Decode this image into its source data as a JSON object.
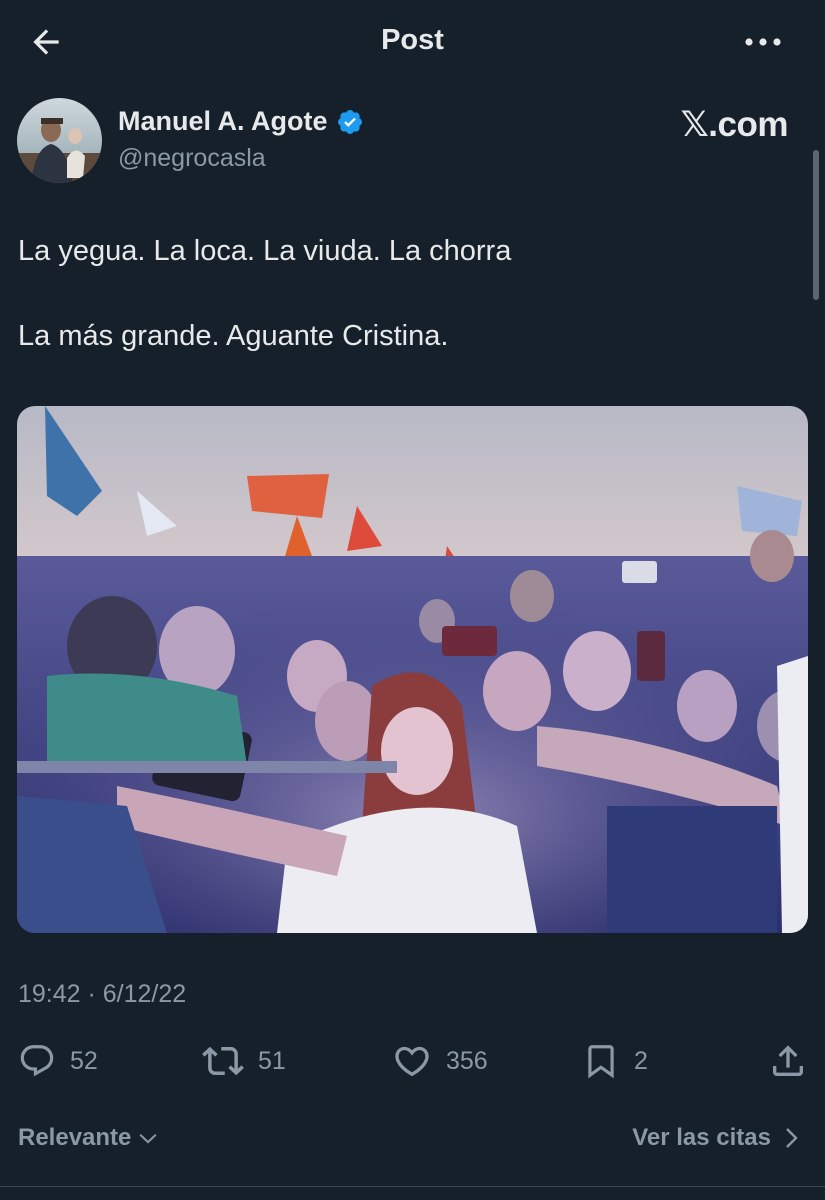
{
  "header": {
    "title": "Post",
    "back_icon": "arrow-left-icon",
    "more_icon": "more-horizontal-icon"
  },
  "author": {
    "name": "Manuel A. Agote",
    "handle": "@negrocasla",
    "verified_icon": "verified-badge-icon",
    "verified_color": "#1d9bf0"
  },
  "watermark": "𝕏.com",
  "tweet": {
    "lines": [
      "La yegua. La loca. La viuda. La chorra",
      "La más grande. Aguante Cristina."
    ]
  },
  "timestamp": "19:42 · 6/12/22",
  "actions": {
    "replies": "52",
    "reposts": "51",
    "likes": "356",
    "bookmarks": "2"
  },
  "footer": {
    "sort_label": "Relevante",
    "quotes_label": "Ver las citas"
  },
  "colors": {
    "background": "#15202b",
    "text": "#e7e9ea",
    "muted": "#8b98a5"
  }
}
